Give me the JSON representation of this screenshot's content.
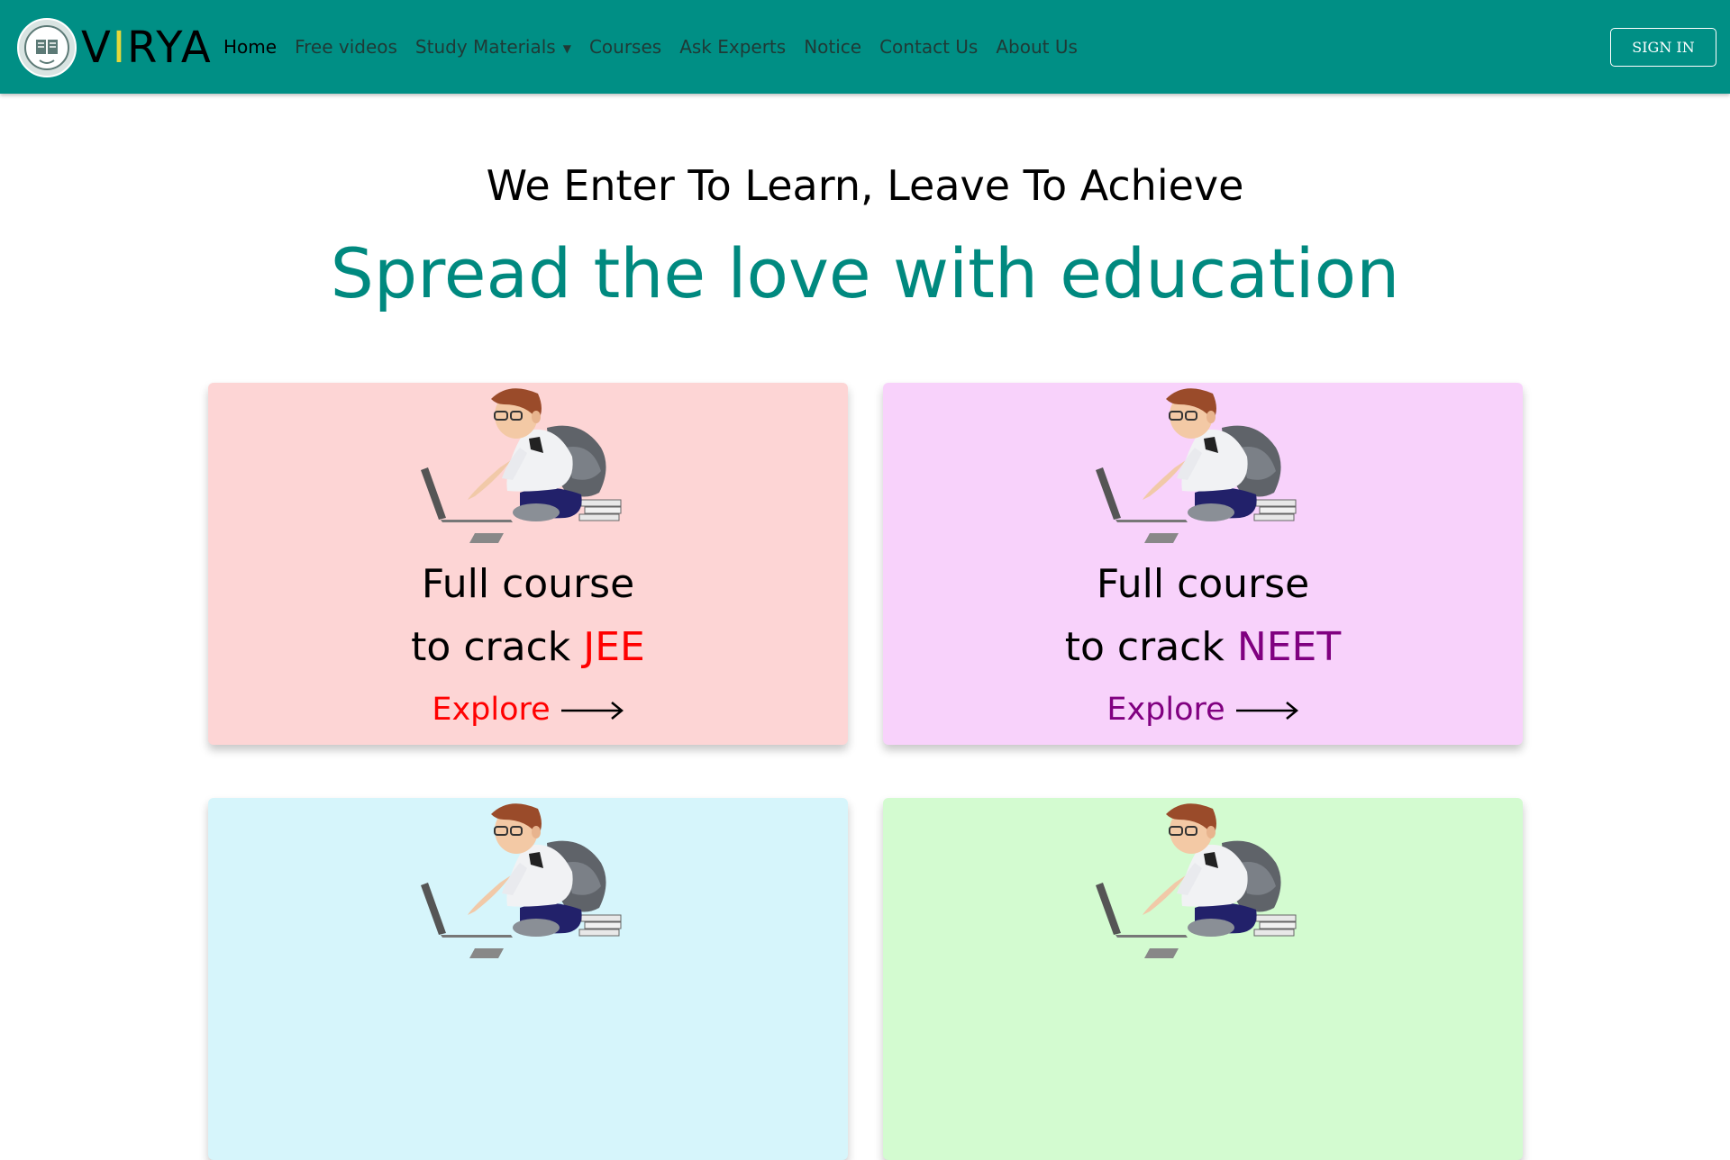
{
  "brand": {
    "logo_text_pre": "V",
    "logo_text_accent": "I",
    "logo_text_post": "RYA",
    "colors": {
      "header": "#008f85",
      "accent_teal": "#00897f",
      "logo_accent": "#e6d83a"
    }
  },
  "nav": {
    "items": [
      {
        "label": "Home",
        "active": true
      },
      {
        "label": "Free videos"
      },
      {
        "label": "Study Materials",
        "dropdown": true
      },
      {
        "label": "Courses"
      },
      {
        "label": "Ask Experts"
      },
      {
        "label": "Notice"
      },
      {
        "label": "Contact Us"
      },
      {
        "label": "About Us"
      }
    ],
    "signin_label": "SIGN IN"
  },
  "hero": {
    "tagline": "We Enter To Learn, Leave To Achieve",
    "headline": "Spread the love with education"
  },
  "cards": [
    {
      "line1": "Full course",
      "line2_prefix": "to crack ",
      "exam": "JEE",
      "exam_color": "#ff0000",
      "bg": "#fdd5d5",
      "explore_label": "Explore"
    },
    {
      "line1": "Full course",
      "line2_prefix": "to crack ",
      "exam": "NEET",
      "exam_color": "#800080",
      "bg": "#f8d2fb",
      "explore_label": "Explore"
    },
    {
      "bg": "#d6f5fb"
    },
    {
      "bg": "#d3fbd0"
    }
  ],
  "icons": [
    "logo-badge-icon",
    "caret-down-icon",
    "student-laptop-illustration",
    "arrow-right-icon"
  ]
}
